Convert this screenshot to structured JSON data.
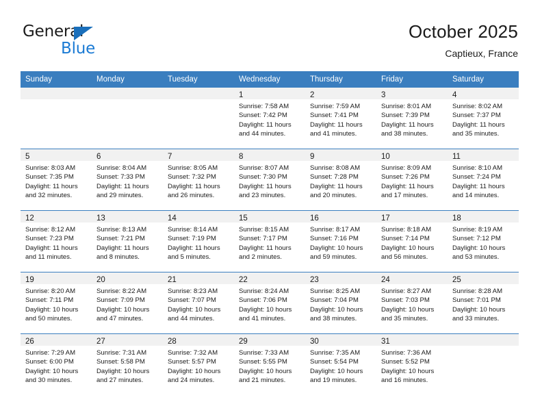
{
  "brand": {
    "line1": "General",
    "line2": "Blue",
    "logo_icon": "triangle-logo-icon",
    "colors": {
      "general": "#1c1c1c",
      "blue": "#1a7ad4",
      "triangle": "#1a6fbb"
    }
  },
  "header": {
    "title": "October 2025",
    "subtitle": "Captieux, France"
  },
  "theme": {
    "header_row_bg": "#3a7ebf",
    "daynum_bg": "#f1f1f1",
    "row_divider": "#3a7ebf",
    "text": "#1a1a1a"
  },
  "weekday_headers": [
    "Sunday",
    "Monday",
    "Tuesday",
    "Wednesday",
    "Thursday",
    "Friday",
    "Saturday"
  ],
  "labels": {
    "sunrise_prefix": "Sunrise:",
    "sunset_prefix": "Sunset:",
    "daylight_prefix": "Daylight:"
  },
  "weeks": [
    [
      {
        "empty": true
      },
      {
        "empty": true
      },
      {
        "empty": true
      },
      {
        "day": "1",
        "sunrise": "Sunrise: 7:58 AM",
        "sunset": "Sunset: 7:42 PM",
        "daylight": "Daylight: 11 hours and 44 minutes."
      },
      {
        "day": "2",
        "sunrise": "Sunrise: 7:59 AM",
        "sunset": "Sunset: 7:41 PM",
        "daylight": "Daylight: 11 hours and 41 minutes."
      },
      {
        "day": "3",
        "sunrise": "Sunrise: 8:01 AM",
        "sunset": "Sunset: 7:39 PM",
        "daylight": "Daylight: 11 hours and 38 minutes."
      },
      {
        "day": "4",
        "sunrise": "Sunrise: 8:02 AM",
        "sunset": "Sunset: 7:37 PM",
        "daylight": "Daylight: 11 hours and 35 minutes."
      }
    ],
    [
      {
        "day": "5",
        "sunrise": "Sunrise: 8:03 AM",
        "sunset": "Sunset: 7:35 PM",
        "daylight": "Daylight: 11 hours and 32 minutes."
      },
      {
        "day": "6",
        "sunrise": "Sunrise: 8:04 AM",
        "sunset": "Sunset: 7:33 PM",
        "daylight": "Daylight: 11 hours and 29 minutes."
      },
      {
        "day": "7",
        "sunrise": "Sunrise: 8:05 AM",
        "sunset": "Sunset: 7:32 PM",
        "daylight": "Daylight: 11 hours and 26 minutes."
      },
      {
        "day": "8",
        "sunrise": "Sunrise: 8:07 AM",
        "sunset": "Sunset: 7:30 PM",
        "daylight": "Daylight: 11 hours and 23 minutes."
      },
      {
        "day": "9",
        "sunrise": "Sunrise: 8:08 AM",
        "sunset": "Sunset: 7:28 PM",
        "daylight": "Daylight: 11 hours and 20 minutes."
      },
      {
        "day": "10",
        "sunrise": "Sunrise: 8:09 AM",
        "sunset": "Sunset: 7:26 PM",
        "daylight": "Daylight: 11 hours and 17 minutes."
      },
      {
        "day": "11",
        "sunrise": "Sunrise: 8:10 AM",
        "sunset": "Sunset: 7:24 PM",
        "daylight": "Daylight: 11 hours and 14 minutes."
      }
    ],
    [
      {
        "day": "12",
        "sunrise": "Sunrise: 8:12 AM",
        "sunset": "Sunset: 7:23 PM",
        "daylight": "Daylight: 11 hours and 11 minutes."
      },
      {
        "day": "13",
        "sunrise": "Sunrise: 8:13 AM",
        "sunset": "Sunset: 7:21 PM",
        "daylight": "Daylight: 11 hours and 8 minutes."
      },
      {
        "day": "14",
        "sunrise": "Sunrise: 8:14 AM",
        "sunset": "Sunset: 7:19 PM",
        "daylight": "Daylight: 11 hours and 5 minutes."
      },
      {
        "day": "15",
        "sunrise": "Sunrise: 8:15 AM",
        "sunset": "Sunset: 7:17 PM",
        "daylight": "Daylight: 11 hours and 2 minutes."
      },
      {
        "day": "16",
        "sunrise": "Sunrise: 8:17 AM",
        "sunset": "Sunset: 7:16 PM",
        "daylight": "Daylight: 10 hours and 59 minutes."
      },
      {
        "day": "17",
        "sunrise": "Sunrise: 8:18 AM",
        "sunset": "Sunset: 7:14 PM",
        "daylight": "Daylight: 10 hours and 56 minutes."
      },
      {
        "day": "18",
        "sunrise": "Sunrise: 8:19 AM",
        "sunset": "Sunset: 7:12 PM",
        "daylight": "Daylight: 10 hours and 53 minutes."
      }
    ],
    [
      {
        "day": "19",
        "sunrise": "Sunrise: 8:20 AM",
        "sunset": "Sunset: 7:11 PM",
        "daylight": "Daylight: 10 hours and 50 minutes."
      },
      {
        "day": "20",
        "sunrise": "Sunrise: 8:22 AM",
        "sunset": "Sunset: 7:09 PM",
        "daylight": "Daylight: 10 hours and 47 minutes."
      },
      {
        "day": "21",
        "sunrise": "Sunrise: 8:23 AM",
        "sunset": "Sunset: 7:07 PM",
        "daylight": "Daylight: 10 hours and 44 minutes."
      },
      {
        "day": "22",
        "sunrise": "Sunrise: 8:24 AM",
        "sunset": "Sunset: 7:06 PM",
        "daylight": "Daylight: 10 hours and 41 minutes."
      },
      {
        "day": "23",
        "sunrise": "Sunrise: 8:25 AM",
        "sunset": "Sunset: 7:04 PM",
        "daylight": "Daylight: 10 hours and 38 minutes."
      },
      {
        "day": "24",
        "sunrise": "Sunrise: 8:27 AM",
        "sunset": "Sunset: 7:03 PM",
        "daylight": "Daylight: 10 hours and 35 minutes."
      },
      {
        "day": "25",
        "sunrise": "Sunrise: 8:28 AM",
        "sunset": "Sunset: 7:01 PM",
        "daylight": "Daylight: 10 hours and 33 minutes."
      }
    ],
    [
      {
        "day": "26",
        "sunrise": "Sunrise: 7:29 AM",
        "sunset": "Sunset: 6:00 PM",
        "daylight": "Daylight: 10 hours and 30 minutes."
      },
      {
        "day": "27",
        "sunrise": "Sunrise: 7:31 AM",
        "sunset": "Sunset: 5:58 PM",
        "daylight": "Daylight: 10 hours and 27 minutes."
      },
      {
        "day": "28",
        "sunrise": "Sunrise: 7:32 AM",
        "sunset": "Sunset: 5:57 PM",
        "daylight": "Daylight: 10 hours and 24 minutes."
      },
      {
        "day": "29",
        "sunrise": "Sunrise: 7:33 AM",
        "sunset": "Sunset: 5:55 PM",
        "daylight": "Daylight: 10 hours and 21 minutes."
      },
      {
        "day": "30",
        "sunrise": "Sunrise: 7:35 AM",
        "sunset": "Sunset: 5:54 PM",
        "daylight": "Daylight: 10 hours and 19 minutes."
      },
      {
        "day": "31",
        "sunrise": "Sunrise: 7:36 AM",
        "sunset": "Sunset: 5:52 PM",
        "daylight": "Daylight: 10 hours and 16 minutes."
      },
      {
        "empty": true
      }
    ]
  ]
}
